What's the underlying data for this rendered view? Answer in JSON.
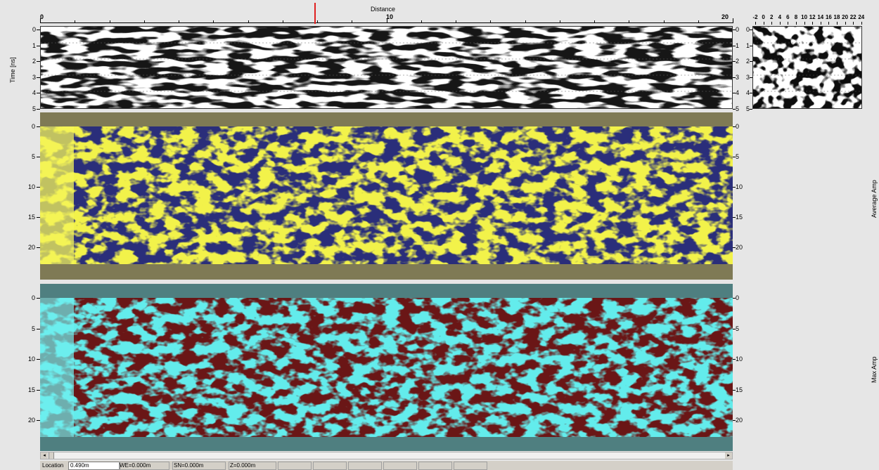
{
  "top_axis": {
    "title": "Distance",
    "ticks": [
      "0",
      "10",
      "20"
    ]
  },
  "radargram": {
    "ylabel": "Time [ns]",
    "yticks": [
      "0",
      "1",
      "2",
      "3",
      "4",
      "5"
    ]
  },
  "avg_panel": {
    "label": "Average Amp",
    "yticks": [
      "0",
      "5",
      "10",
      "15",
      "20"
    ],
    "colors": {
      "high": "#f2f24a",
      "low": "#2a2f7a",
      "border": "#7f7a55"
    }
  },
  "max_panel": {
    "label": "Max Amp",
    "yticks": [
      "0",
      "5",
      "10",
      "15",
      "20"
    ],
    "colors": {
      "high": "#63ecec",
      "low": "#6b1515",
      "border": "#4f7f80"
    }
  },
  "inset": {
    "xticks": [
      "-2",
      "0",
      "2",
      "4",
      "6",
      "8",
      "10",
      "12",
      "14",
      "16",
      "18",
      "20",
      "22",
      "24"
    ],
    "yticks": [
      "0",
      "1",
      "2",
      "3",
      "4",
      "5"
    ]
  },
  "status_bar": {
    "location_label": "Location",
    "location_value": "0.490m",
    "we": "WE=0.000m",
    "sn": "SN=0.000m",
    "z": "Z=0.000m"
  },
  "marker_color": "#e02020"
}
